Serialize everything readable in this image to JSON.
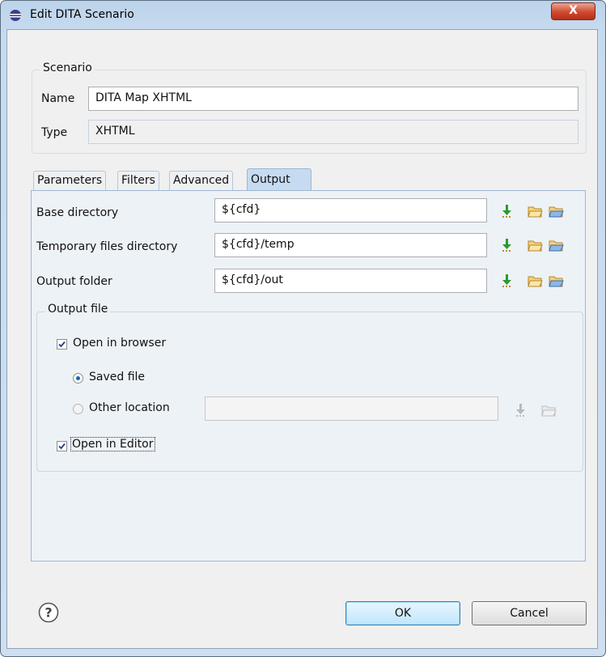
{
  "window": {
    "title": "Edit DITA Scenario",
    "close_glyph": "X"
  },
  "scenario": {
    "legend": "Scenario",
    "name_label": "Name",
    "name_value": "DITA Map XHTML",
    "type_label": "Type",
    "type_value": "XHTML"
  },
  "tabs": [
    {
      "label": "Parameters",
      "active": false
    },
    {
      "label": "Filters",
      "active": false
    },
    {
      "label": "Advanced",
      "active": false
    },
    {
      "label": "Output",
      "active": true
    }
  ],
  "output": {
    "rows": [
      {
        "label": "Base directory",
        "value": "${cfd}"
      },
      {
        "label": "Temporary files directory",
        "value": "${cfd}/temp"
      },
      {
        "label": "Output folder",
        "value": "${cfd}/out"
      }
    ],
    "output_file": {
      "legend": "Output file",
      "open_in_browser": {
        "label": "Open in browser",
        "checked": true
      },
      "saved_file": {
        "label": "Saved file",
        "selected": true
      },
      "other_location": {
        "label": "Other location",
        "selected": false,
        "value": ""
      },
      "open_in_editor": {
        "label": "Open in Editor",
        "checked": true
      }
    }
  },
  "buttons": {
    "ok": "OK",
    "cancel": "Cancel"
  },
  "icons": [
    "app-icon",
    "close-icon",
    "insert-editor-variables-icon",
    "browse-local-folder-icon",
    "browse-url-icon",
    "help-icon",
    "checkmark-icon"
  ],
  "colors": {
    "accent": "#1f5fb8",
    "active_tab": "#c6dbf1",
    "panel": "#edf2f7",
    "close": "#cf4a30"
  }
}
